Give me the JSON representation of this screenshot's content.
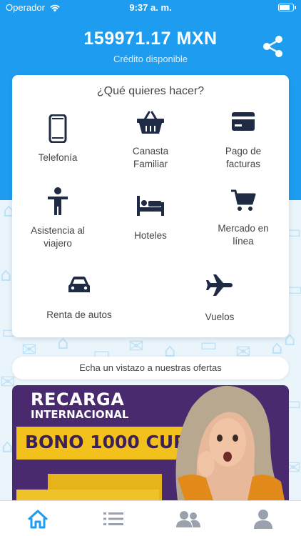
{
  "status_bar": {
    "carrier": "Operador",
    "time": "9:37 a. m.",
    "battery_level": 0.8
  },
  "header": {
    "balance": "159971.17 MXN",
    "balance_label": "Crédito disponible",
    "share_icon": "share-icon"
  },
  "menu": {
    "title": "¿Qué quieres hacer?",
    "items": [
      {
        "label": "Telefonía",
        "icon": "phone-icon"
      },
      {
        "label": "Canasta\nFamiliar",
        "icon": "basket-icon"
      },
      {
        "label": "Pago de\nfacturas",
        "icon": "card-icon"
      },
      {
        "label": "Asistencia al\nviajero",
        "icon": "person-icon"
      },
      {
        "label": "Hoteles",
        "icon": "bed-icon"
      },
      {
        "label": "Mercado en\nlínea",
        "icon": "cart-icon"
      },
      {
        "label": "Renta de autos",
        "icon": "car-icon"
      },
      {
        "label": "Vuelos",
        "icon": "plane-icon"
      }
    ]
  },
  "offers": {
    "label": "Echa un vistazo a nuestras ofertas"
  },
  "banner": {
    "line1": "RECARGA",
    "line2": "INTERNACIONAL",
    "bono": "BONO 1000 CUP"
  },
  "tabbar": {
    "tabs": [
      {
        "icon": "home-icon",
        "active": true
      },
      {
        "icon": "list-icon",
        "active": false
      },
      {
        "icon": "users-icon",
        "active": false
      },
      {
        "icon": "profile-icon",
        "active": false
      }
    ]
  },
  "colors": {
    "primary": "#1e9df0",
    "icon_dark": "#1f2a44",
    "active_tab": "#1e9df0",
    "inactive_tab": "#9aa3ad"
  }
}
